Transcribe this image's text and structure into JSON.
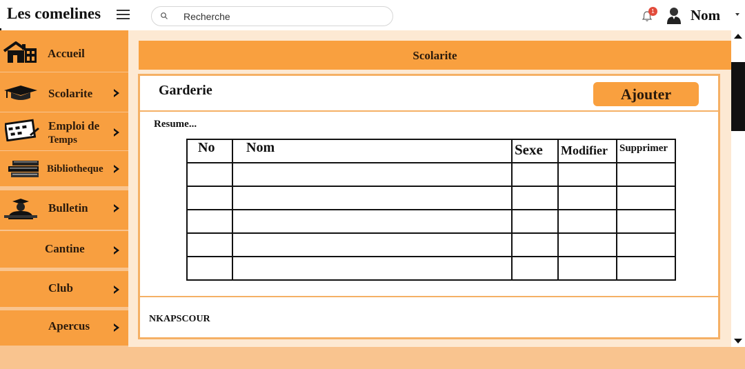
{
  "app": {
    "title": "Les comelines"
  },
  "search": {
    "placeholder": "Recherche"
  },
  "notifications": {
    "count": "1",
    "icon": "bell-icon"
  },
  "user": {
    "name": "Nom",
    "avatar_icon": "user-avatar-icon"
  },
  "sidebar": {
    "items": [
      {
        "label": "Accueil",
        "icon": "home-icon"
      },
      {
        "label": "Scolarite",
        "icon": "graduation-cap-icon"
      },
      {
        "label": "Emploi de",
        "label2": "Temps",
        "icon": "calendar-icon"
      },
      {
        "label": "Bibliotheque",
        "icon": "books-icon"
      },
      {
        "label": "Bulletin",
        "icon": "report-card-icon"
      },
      {
        "label": "Cantine"
      },
      {
        "label": "Club"
      },
      {
        "label": "Apercus"
      }
    ]
  },
  "main": {
    "header_title": "Scolarite",
    "card_title": "Garderie",
    "add_button": "Ajouter",
    "summary": "Resume...",
    "table": {
      "columns": [
        "No",
        "Nom",
        "Sexe",
        "Modifier",
        "Supprimer"
      ],
      "rows": [
        [
          "",
          "",
          "",
          "",
          ""
        ],
        [
          "",
          "",
          "",
          "",
          ""
        ],
        [
          "",
          "",
          "",
          "",
          ""
        ],
        [
          "",
          "",
          "",
          "",
          ""
        ],
        [
          "",
          "",
          "",
          "",
          ""
        ]
      ]
    },
    "footer": "NKAPSCOUR"
  },
  "colors": {
    "accent": "#f89f40",
    "background": "#f9c48f",
    "panel": "#fde9d3",
    "border": "#f5b065"
  }
}
